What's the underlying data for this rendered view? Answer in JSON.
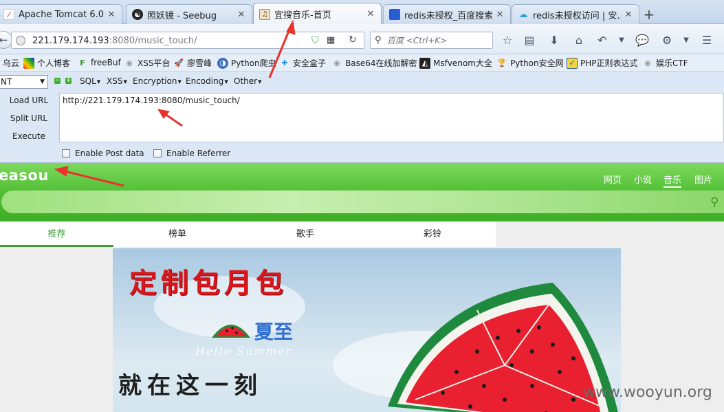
{
  "tabs": [
    {
      "title": "Apache Tomcat 6.0 ...",
      "icon": "tomcat-icon"
    },
    {
      "title": "照妖镜 - Seebug",
      "icon": "seebug-icon"
    },
    {
      "title": "宜搜音乐-首页",
      "icon": "easou-icon",
      "active": true
    },
    {
      "title": "redis未授权_百度搜索",
      "icon": "baidu-icon"
    },
    {
      "title": "redis未授权访问 | 安...",
      "icon": "cloud-icon"
    }
  ],
  "nav": {
    "url_host": "221.179.174.193",
    "url_rest": ":8080/music_touch/",
    "search_placeholder": "百度 <Ctrl+K>"
  },
  "bookmarks": [
    {
      "label": "乌云",
      "icon": "wooyun-icon"
    },
    {
      "label": "个人博客",
      "icon": "blog-icon"
    },
    {
      "label": "freeBuf",
      "icon": "freebuf-icon"
    },
    {
      "label": "XSS平台",
      "icon": "globe-icon"
    },
    {
      "label": "廖雪峰",
      "icon": "rocket-icon"
    },
    {
      "label": "Python爬虫",
      "icon": "python-icon"
    },
    {
      "label": "安全盒子",
      "icon": "box-icon"
    },
    {
      "label": "Base64在线加解密",
      "icon": "globe-icon"
    },
    {
      "label": "Msfvenom大全",
      "icon": "msf-icon"
    },
    {
      "label": "Python安全网",
      "icon": "trophy-icon"
    },
    {
      "label": "PHP正则表达式",
      "icon": "php-icon"
    },
    {
      "label": "娱乐CTF",
      "icon": "globe-icon"
    }
  ],
  "hackbar": {
    "select_value": "NT",
    "menus": [
      "SQL",
      "XSS",
      "Encryption",
      "Encoding",
      "Other"
    ],
    "load_url": "Load URL",
    "split_url": "Split URL",
    "execute": "Execute",
    "url_value": "http://221.179.174.193:8080/music_touch/",
    "post_label": "Enable Post data",
    "referrer_label": "Enable Referrer"
  },
  "page": {
    "logo": "easou",
    "topnav": [
      "网页",
      "小说",
      "音乐",
      "图片"
    ],
    "topnav_active": "音乐",
    "tabs": [
      "推荐",
      "榜单",
      "歌手",
      "彩铃"
    ],
    "banner_headline": "定制包月包",
    "banner_xiazhi": "夏至",
    "banner_hello": "Hello Summer",
    "banner_slogan": "就在这一刻"
  },
  "watermark": "www.wooyun.org",
  "colors": {
    "accent_green": "#3aa035",
    "annotation_red": "#e8322b",
    "headline_red": "#d8171d"
  }
}
